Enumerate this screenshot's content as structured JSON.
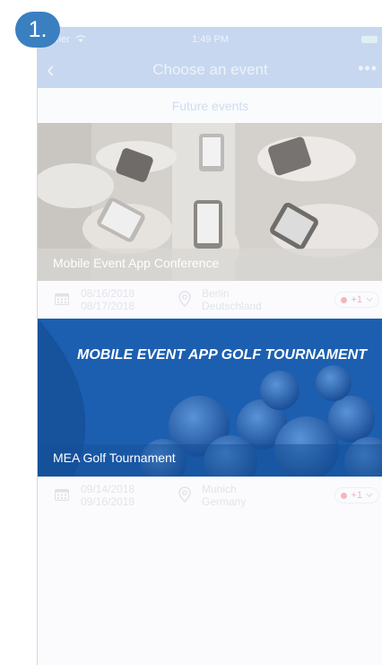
{
  "step": {
    "label": "1."
  },
  "status_bar": {
    "carrier": "rier",
    "time": "1:49 PM"
  },
  "nav": {
    "back": "‹",
    "title": "Choose an event",
    "more": "•••"
  },
  "tab": {
    "label": "Future events"
  },
  "events": [
    {
      "name": "Mobile Event App Conference",
      "date_start": "08/16/2018",
      "date_end": "08/17/2018",
      "city": "Berlin",
      "country": "Deutschland",
      "attendees": "+1"
    },
    {
      "name": "MEA Golf Tournament",
      "banner_text": "MOBILE EVENT APP GOLF TOURNAMENT",
      "date_start": "09/14/2018",
      "date_end": "09/16/2018",
      "city": "Munich",
      "country": "Germany",
      "attendees": "+1"
    }
  ],
  "icons": {
    "back": "chevron-left-icon",
    "more": "more-horizontal-icon",
    "calendar": "calendar-icon",
    "location": "location-pin-icon",
    "attendee": "attendee-dot-icon",
    "dropdown": "chevron-down-icon"
  },
  "colors": {
    "header": "#c7d7ef",
    "accent_step": "#3a7fc0",
    "golf_banner": "#1c5fb0"
  }
}
